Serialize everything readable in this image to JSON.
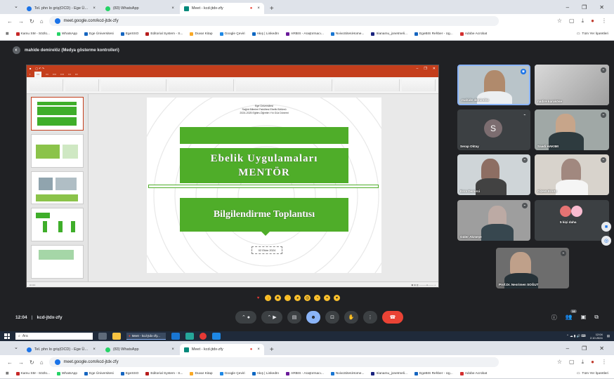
{
  "browser_top": {
    "tabs": [
      {
        "label": "Tel. phn lo griş(OCD) - Ege Ü...",
        "color": "#1a73e8",
        "active": false
      },
      {
        "label": "(83) WhatsApp",
        "color": "#25d366",
        "active": false
      },
      {
        "label": "Meet - kcd-jtdx-zfy",
        "color": "#00897b",
        "active": true
      }
    ],
    "new_tab": "+",
    "url": "meet.google.com/kcd-jtdx-zfy",
    "bookmarks": [
      "Kamu SM - Sözlü...",
      "WhatsApp",
      "Ege Üniversitesi",
      "EgeSSO",
      "Editorial System - S...",
      "Duvar Kitap",
      "Google Çeviri",
      "Akış | LinkedIn",
      "ARBIS - Araştırmacı...",
      "NvivoSitesiHome...",
      "Irianamu_jonetmeli...",
      "EgeBIS Rehber - Ug...",
      "Adobe Acrobat"
    ],
    "all_bookmarks": "Tüm Yer İşaretleri"
  },
  "meet": {
    "presenter_label": "mahide demirelöz (Medya gösterme kontrolleri)",
    "slide": {
      "header_lines": [
        "Ege Üniversitesi",
        "Sağlık Bilimleri Fakültesi Ebelik Bölümü",
        "2024-2025 Eğitim-Öğretim Yılı Güz Dönemi"
      ],
      "title_line1": "Ebelik Uygulamaları",
      "title_line2": "MENTÖR",
      "title_line3": "Bilgilendirme Toplantısı",
      "date": "02 Ekim 2024"
    },
    "participants": [
      {
        "name": "mahide demirelöz",
        "speaking": true
      },
      {
        "name": "nadire karaköse"
      },
      {
        "name": "Serap Oktay",
        "initial": "S"
      },
      {
        "name": "Saadi HAKIMI"
      },
      {
        "name": "Esra Demirci"
      },
      {
        "name": "Gizem Ersöz"
      },
      {
        "name": "Güler Akmeşe"
      },
      {
        "name": "5 kişi daha"
      },
      {
        "name": "Prof.Dr. Nesrimen SOĞUT"
      }
    ],
    "time": "12:04",
    "meeting_code": "kcd-jtdx-zfy",
    "people_count": "16"
  },
  "taskbar": {
    "search_placeholder": "Ara",
    "meet_task": "Meet - kcd-jtdx-zfy...",
    "clock_time": "12:04",
    "clock_date": "2.10.2024"
  }
}
